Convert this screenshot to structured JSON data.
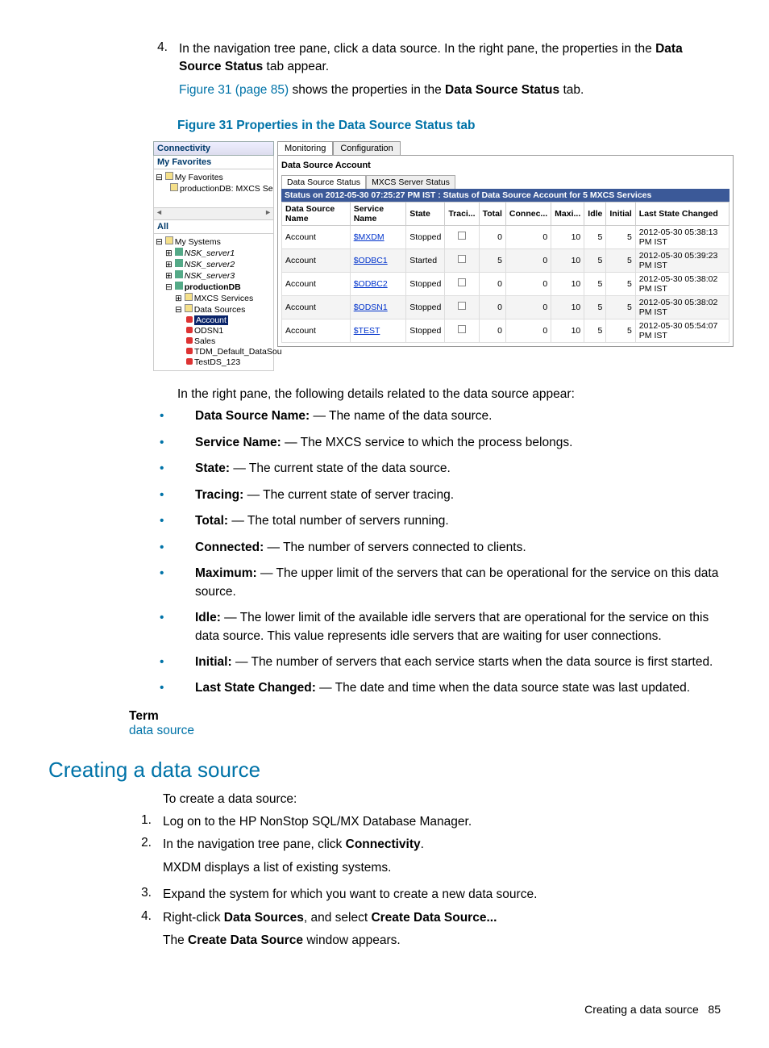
{
  "step4": {
    "num": "4.",
    "text_a": "In the navigation tree pane, click a data source. In the right pane, the properties in the ",
    "text_b": "Data Source Status",
    "text_c": " tab appear.",
    "fig_ref_link": "Figure 31 (page 85)",
    "fig_ref_rest": " shows the properties in the ",
    "fig_ref_bold": "Data Source Status",
    "fig_ref_end": " tab."
  },
  "fig_caption": "Figure 31 Properties in the Data Source Status tab",
  "screenshot": {
    "connectivity": "Connectivity",
    "my_favorites": "My Favorites",
    "fav_item1": "My Favorites",
    "fav_item2": "productionDB: MXCS Service",
    "all": "All",
    "tree": {
      "mysystems": "My Systems",
      "s1": "NSK_server1",
      "s2": "NSK_server2",
      "s3": "NSK_server3",
      "prod": "productionDB",
      "mxcs": "MXCS Services",
      "ds": "Data Sources",
      "acct": "Account",
      "odsn1": "ODSN1",
      "sales": "Sales",
      "tdm": "TDM_Default_DataSou",
      "test": "TestDS_123"
    },
    "tab_monitoring": "Monitoring",
    "tab_config": "Configuration",
    "account_hdr": "Data Source Account",
    "subtab_status": "Data Source Status",
    "subtab_server": "MXCS Server Status",
    "status_bar": "Status on 2012-05-30 07:25:27 PM IST : Status of Data Source Account for 5 MXCS Services",
    "columns": [
      "Data Source Name",
      "Service Name",
      "State",
      "Traci...",
      "Total",
      "Connec...",
      "Maxi...",
      "Idle",
      "Initial",
      "Last State Changed"
    ],
    "rows": [
      {
        "dsn": "Account",
        "svc": "$MXDM",
        "state": "Stopped",
        "total": "0",
        "conn": "0",
        "max": "10",
        "idle": "5",
        "init": "5",
        "last": "2012-05-30 05:38:13 PM IST",
        "alt": false
      },
      {
        "dsn": "Account",
        "svc": "$ODBC1",
        "state": "Started",
        "total": "5",
        "conn": "0",
        "max": "10",
        "idle": "5",
        "init": "5",
        "last": "2012-05-30 05:39:23 PM IST",
        "alt": true
      },
      {
        "dsn": "Account",
        "svc": "$ODBC2",
        "state": "Stopped",
        "total": "0",
        "conn": "0",
        "max": "10",
        "idle": "5",
        "init": "5",
        "last": "2012-05-30 05:38:02 PM IST",
        "alt": false
      },
      {
        "dsn": "Account",
        "svc": "$ODSN1",
        "state": "Stopped",
        "total": "0",
        "conn": "0",
        "max": "10",
        "idle": "5",
        "init": "5",
        "last": "2012-05-30 05:38:02 PM IST",
        "alt": true
      },
      {
        "dsn": "Account",
        "svc": "$TEST",
        "state": "Stopped",
        "total": "0",
        "conn": "0",
        "max": "10",
        "idle": "5",
        "init": "5",
        "last": "2012-05-30 05:54:07 PM IST",
        "alt": false
      }
    ]
  },
  "intro_right": "In the right pane, the following details related to the data source appear:",
  "bullets": [
    {
      "b": "Data Source Name:",
      "t": " — The name of the data source."
    },
    {
      "b": "Service Name:",
      "t": " — The MXCS service to which the process belongs."
    },
    {
      "b": "State:",
      "t": " — The current state of the data source."
    },
    {
      "b": "Tracing:",
      "t": " — The current state of server tracing."
    },
    {
      "b": "Total:",
      "t": " — The total number of servers running."
    },
    {
      "b": "Connected:",
      "t": " — The number of servers connected to clients."
    },
    {
      "b": "Maximum:",
      "t": " — The upper limit of the servers that can be operational for the service on this data source."
    },
    {
      "b": "Idle:",
      "t": " — The lower limit of the available idle servers that are operational for the service on this data source. This value represents idle servers that are waiting for user connections."
    },
    {
      "b": "Initial:",
      "t": " — The number of servers that each service starts when the data source is first started."
    },
    {
      "b": "Last State Changed:",
      "t": " — The date and time when the data source state was last updated."
    }
  ],
  "term_label": "Term",
  "term_link": "data source",
  "section_title": "Creating a data source",
  "create_intro": "To create a data source:",
  "steps": [
    {
      "n": "1.",
      "body": "Log on to the HP NonStop SQL/MX Database Manager."
    },
    {
      "n": "2.",
      "body_a": "In the navigation tree pane, click ",
      "body_b": "Connectivity",
      "body_c": ".",
      "sub": "MXDM displays a list of existing systems."
    },
    {
      "n": "3.",
      "body": "Expand the system for which you want to create a new data source."
    },
    {
      "n": "4.",
      "body_a": "Right-click ",
      "body_b": "Data Sources",
      "body_c": ", and select ",
      "body_d": "Create Data Source...",
      "sub_a": "The ",
      "sub_b": "Create Data Source",
      "sub_c": " window appears."
    }
  ],
  "footer_a": "Creating a data source",
  "footer_b": "85"
}
